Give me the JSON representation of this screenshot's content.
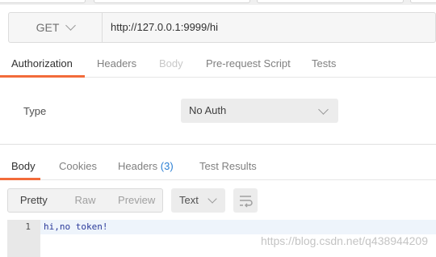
{
  "request": {
    "method": "GET",
    "url": "http://127.0.0.1:9999/hi"
  },
  "request_tabs": [
    {
      "label": "Authorization",
      "active": true
    },
    {
      "label": "Headers"
    },
    {
      "label": "Body",
      "disabled": true
    },
    {
      "label": "Pre-request Script"
    },
    {
      "label": "Tests"
    }
  ],
  "auth": {
    "type_label": "Type",
    "type_value": "No Auth"
  },
  "response_tabs": [
    {
      "label": "Body",
      "active": true
    },
    {
      "label": "Cookies"
    },
    {
      "label": "Headers",
      "count": "(3)"
    },
    {
      "label": "Test Results"
    }
  ],
  "body_view": {
    "modes": [
      "Pretty",
      "Raw",
      "Preview"
    ],
    "active_mode": "Pretty",
    "format": "Text"
  },
  "response_body": {
    "lines": [
      {
        "number": "1",
        "text": "hi,no token!"
      }
    ]
  },
  "watermark": "https://blog.csdn.net/q438944209",
  "colors": {
    "accent": "#f26b3a",
    "count": "#2a7fd4"
  }
}
